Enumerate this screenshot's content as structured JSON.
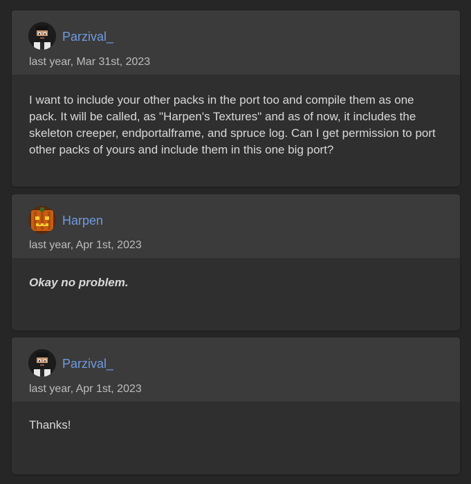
{
  "comments": [
    {
      "author": "Parzival_",
      "avatar_icon": "bearded-man-avatar-icon",
      "timestamp": "last year, Mar 31st, 2023",
      "body": "I want to include your other packs in the port too and compile them as one pack. It will be called, as \"Harpen's Textures\" and as of now, it includes the skeleton creeper, endportalframe, and spruce log. Can I get permission to port other packs of yours and include them in this one big port?"
    },
    {
      "author": "Harpen",
      "avatar_icon": "pumpkin-avatar-icon",
      "timestamp": "last year, Apr 1st, 2023",
      "body": "Okay no problem."
    },
    {
      "author": "Parzival_",
      "avatar_icon": "bearded-man-avatar-icon",
      "timestamp": "last year, Apr 1st, 2023",
      "body": "Thanks!"
    }
  ],
  "colors": {
    "background": "#262626",
    "card": "#2f2f2f",
    "card_header": "#3b3b3b",
    "username": "#6f9be0",
    "body_text": "#d9d9d9",
    "timestamp": "#bdbdbd"
  }
}
